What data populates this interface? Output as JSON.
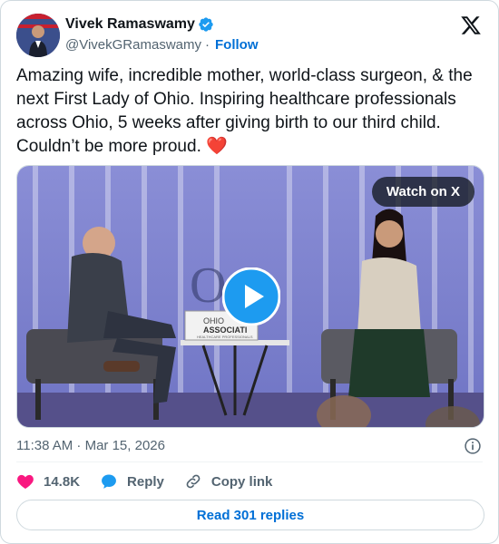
{
  "author": {
    "name": "Vivek Ramaswamy",
    "handle": "@VivekGRamaswamy",
    "separator": "·",
    "follow_label": "Follow",
    "verified_icon": "verified-badge-icon"
  },
  "tweet": {
    "text": "Amazing wife, incredible mother, world-class surgeon, & the next First Lady of Ohio. Inspiring healthcare professionals across Ohio, 5 weeks after giving birth to our third child. Couldn’t be more proud.",
    "emoji": "❤️"
  },
  "media": {
    "watch_label": "Watch on X",
    "banner_text_1": "OHIO",
    "banner_text_2": "ASSOCIATI",
    "banner_text_3": "HEALTHCARE PROFESSIONALS"
  },
  "meta": {
    "timestamp": "11:38 AM · Mar 15, 2026"
  },
  "actions": {
    "likes": "14.8K",
    "reply_label": "Reply",
    "copy_label": "Copy link"
  },
  "footer": {
    "read_replies_label": "Read 301 replies"
  },
  "colors": {
    "brand_blue": "#006fd6",
    "like_red": "#f91880",
    "verified_blue": "#1d9bf0"
  }
}
